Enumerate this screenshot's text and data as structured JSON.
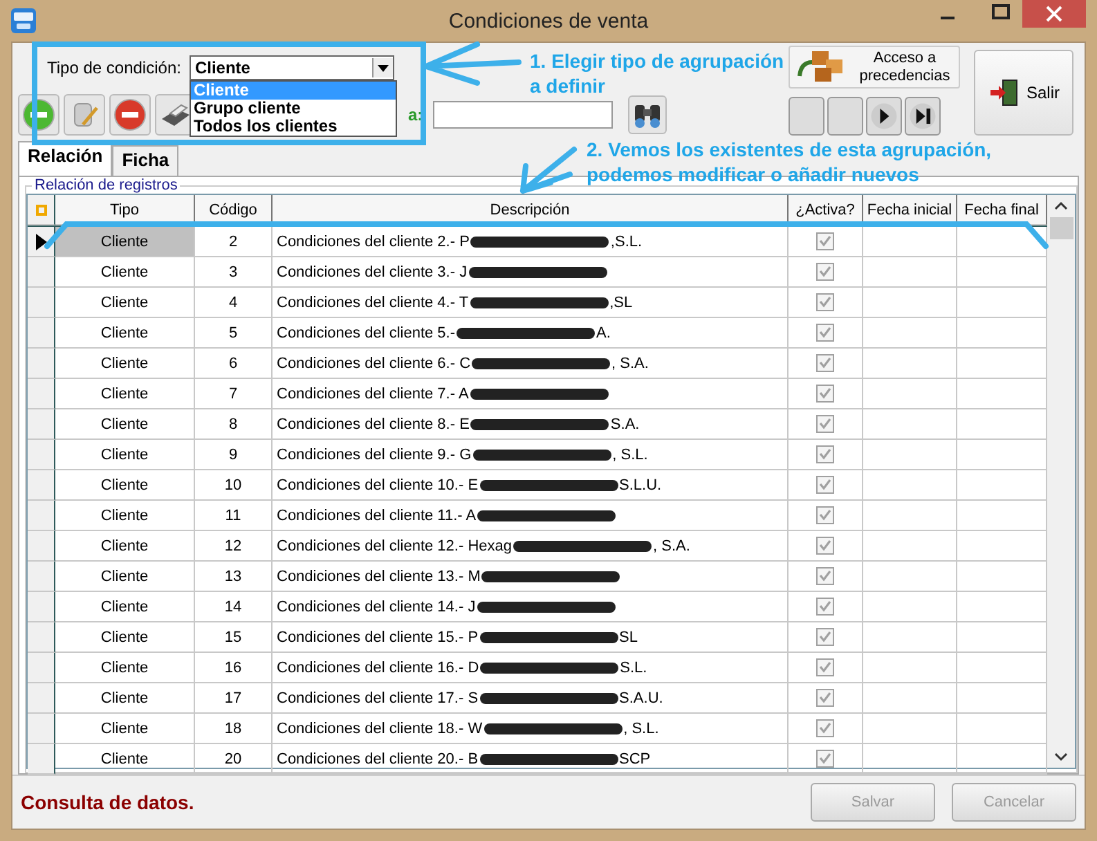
{
  "window": {
    "title": "Condiciones de venta"
  },
  "filter": {
    "label": "Tipo de condición:",
    "value": "Cliente",
    "open": true,
    "options": [
      {
        "label": "Cliente",
        "selected": true
      },
      {
        "label": "Grupo cliente",
        "selected": false
      },
      {
        "label": "Todos los clientes",
        "selected": false
      }
    ]
  },
  "access_button": {
    "lines": [
      "Acceso a",
      "precedencias"
    ]
  },
  "exit_button": {
    "label": "Salir"
  },
  "search_label": "a:",
  "tabs": [
    {
      "label": "Relación",
      "selected": true
    },
    {
      "label": "Ficha",
      "selected": false
    }
  ],
  "group_title": "Relación de registros",
  "table": {
    "columns": [
      "Tipo",
      "Código",
      "Descripción",
      "¿Activa?",
      "Fecha inicial",
      "Fecha final"
    ],
    "rows": [
      {
        "selected": true,
        "tipo": "Cliente",
        "codigo": "2",
        "desc_start": "Condiciones del cliente 2.- P",
        "desc_end": ",S.L.",
        "checked": true
      },
      {
        "selected": false,
        "tipo": "Cliente",
        "codigo": "3",
        "desc_start": "Condiciones del cliente 3.- J",
        "checked": true
      },
      {
        "selected": false,
        "tipo": "Cliente",
        "codigo": "4",
        "desc_start": "Condiciones del cliente 4.- T",
        "desc_end": ",SL",
        "checked": true
      },
      {
        "selected": false,
        "tipo": "Cliente",
        "codigo": "5",
        "desc_start": "Condiciones del cliente 5.-",
        "desc_end": "A.",
        "checked": true
      },
      {
        "selected": false,
        "tipo": "Cliente",
        "codigo": "6",
        "desc_start": "Condiciones del cliente 6.- C",
        "desc_end": ", S.A.",
        "checked": true
      },
      {
        "selected": false,
        "tipo": "Cliente",
        "codigo": "7",
        "desc_start": "Condiciones del cliente 7.- A",
        "checked": true
      },
      {
        "selected": false,
        "tipo": "Cliente",
        "codigo": "8",
        "desc_start": "Condiciones del cliente 8.- E",
        "desc_end": "S.A.",
        "checked": true
      },
      {
        "selected": false,
        "tipo": "Cliente",
        "codigo": "9",
        "desc_start": "Condiciones del cliente 9.- G",
        "desc_end": ", S.L.",
        "checked": true
      },
      {
        "selected": false,
        "tipo": "Cliente",
        "codigo": "10",
        "desc_start": "Condiciones del cliente 10.- E",
        "desc_end": "S.L.U.",
        "checked": true
      },
      {
        "selected": false,
        "tipo": "Cliente",
        "codigo": "11",
        "desc_start": "Condiciones del cliente 11.- A",
        "checked": true
      },
      {
        "selected": false,
        "tipo": "Cliente",
        "codigo": "12",
        "desc_start": "Condiciones del cliente 12.- Hexag",
        "desc_end": ", S.A.",
        "checked": true
      },
      {
        "selected": false,
        "tipo": "Cliente",
        "codigo": "13",
        "desc_start": "Condiciones del cliente 13.- M",
        "checked": true
      },
      {
        "selected": false,
        "tipo": "Cliente",
        "codigo": "14",
        "desc_start": "Condiciones del cliente 14.- J",
        "checked": true
      },
      {
        "selected": false,
        "tipo": "Cliente",
        "codigo": "15",
        "desc_start": "Condiciones del cliente 15.- P",
        "desc_end": "SL",
        "checked": true
      },
      {
        "selected": false,
        "tipo": "Cliente",
        "codigo": "16",
        "desc_start": "Condiciones del cliente 16.- D",
        "desc_end": "S.L.",
        "checked": true
      },
      {
        "selected": false,
        "tipo": "Cliente",
        "codigo": "17",
        "desc_start": "Condiciones del cliente 17.- S",
        "desc_end": "S.A.U.",
        "checked": true
      },
      {
        "selected": false,
        "tipo": "Cliente",
        "codigo": "18",
        "desc_start": "Condiciones del cliente 18.- W",
        "desc_end": ", S.L.",
        "checked": true
      },
      {
        "selected": false,
        "tipo": "Cliente",
        "codigo": "20",
        "desc_start": "Condiciones del cliente 20.- B",
        "desc_end": "SCP",
        "checked": true
      }
    ]
  },
  "status": "Consulta de datos.",
  "buttons": [
    {
      "label": "Salvar",
      "disabled": true
    },
    {
      "label": "Cancelar",
      "disabled": true
    }
  ],
  "annotations": [
    {
      "lines": [
        "1. Elegir tipo de agrupación",
        "a definir"
      ]
    },
    {
      "lines": [
        "2. Vemos los existentes de esta agrupación,",
        "podemos modificar o añadir nuevos"
      ]
    }
  ]
}
